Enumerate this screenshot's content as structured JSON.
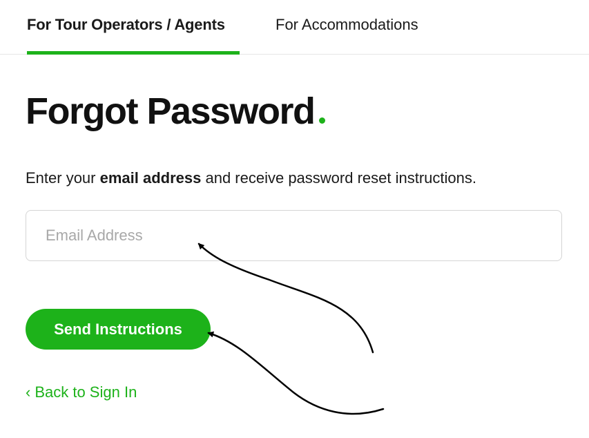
{
  "tabs": [
    {
      "label": "For Tour Operators / Agents",
      "active": true
    },
    {
      "label": "For Accommodations",
      "active": false
    }
  ],
  "page_title": "Forgot Password",
  "instructions": {
    "prefix": "Enter your ",
    "emphasis": "email address",
    "suffix": " and receive password reset instructions."
  },
  "email_field": {
    "placeholder": "Email Address",
    "value": ""
  },
  "send_button_label": "Send Instructions",
  "back_link": {
    "chevron": "‹",
    "label": "Back to Sign In"
  },
  "colors": {
    "accent": "#1db21a",
    "text": "#111111",
    "placeholder": "#a8a8a8",
    "border": "#d4d4d4"
  },
  "icons": [
    "chevron-left-icon",
    "arrow-annotation"
  ]
}
